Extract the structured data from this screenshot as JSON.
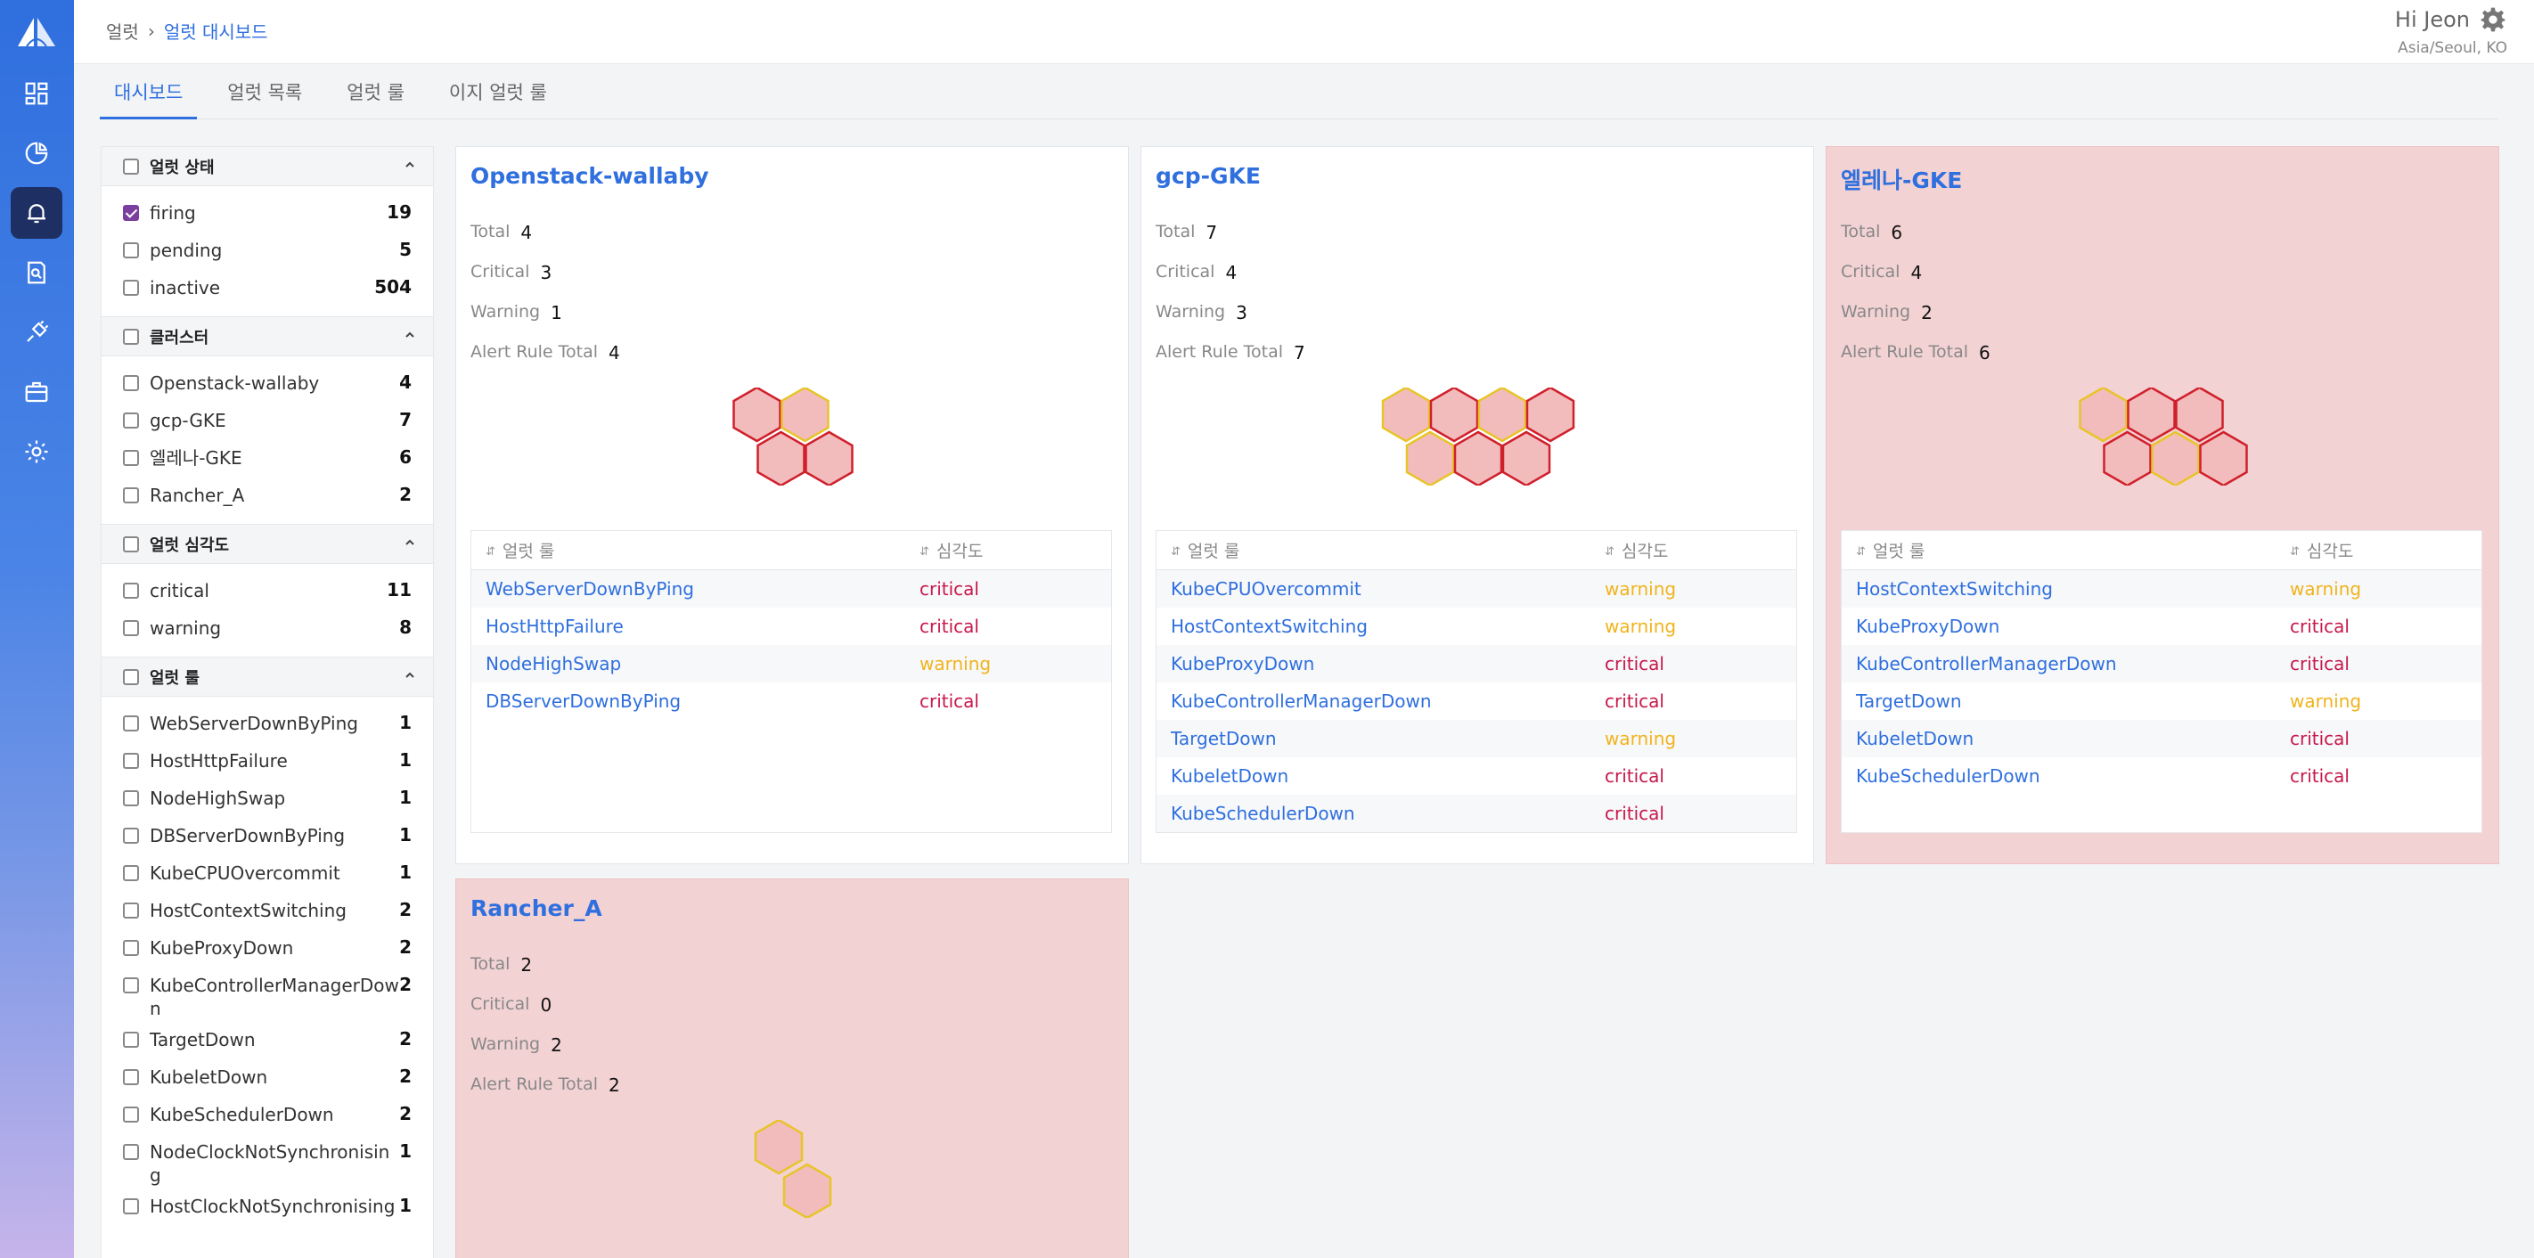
{
  "header": {
    "breadcrumb": [
      "얼럿",
      "얼럿 대시보드"
    ],
    "user_greeting": "Hi Jeon",
    "timezone": "Asia/Seoul, KO"
  },
  "tabs": [
    {
      "label": "대시보드",
      "active": true
    },
    {
      "label": "얼럿 목록",
      "active": false
    },
    {
      "label": "얼럿 룰",
      "active": false
    },
    {
      "label": "이지 얼럿 룰",
      "active": false
    }
  ],
  "filters": {
    "status": {
      "title": "얼럿 상태",
      "items": [
        {
          "label": "firing",
          "count": "19",
          "checked": true
        },
        {
          "label": "pending",
          "count": "5",
          "checked": false
        },
        {
          "label": "inactive",
          "count": "504",
          "checked": false
        }
      ]
    },
    "cluster": {
      "title": "클러스터",
      "items": [
        {
          "label": "Openstack-wallaby",
          "count": "4"
        },
        {
          "label": "gcp-GKE",
          "count": "7"
        },
        {
          "label": "엘레나-GKE",
          "count": "6"
        },
        {
          "label": "Rancher_A",
          "count": "2"
        }
      ]
    },
    "severity": {
      "title": "얼럿 심각도",
      "items": [
        {
          "label": "critical",
          "count": "11"
        },
        {
          "label": "warning",
          "count": "8"
        }
      ]
    },
    "rules": {
      "title": "얼럿 룰",
      "items": [
        {
          "label": "WebServerDownByPing",
          "count": "1"
        },
        {
          "label": "HostHttpFailure",
          "count": "1"
        },
        {
          "label": "NodeHighSwap",
          "count": "1"
        },
        {
          "label": "DBServerDownByPing",
          "count": "1"
        },
        {
          "label": "KubeCPUOvercommit",
          "count": "1"
        },
        {
          "label": "HostContextSwitching",
          "count": "2"
        },
        {
          "label": "KubeProxyDown",
          "count": "2"
        },
        {
          "label": "KubeControllerManagerDown",
          "count": "2"
        },
        {
          "label": "TargetDown",
          "count": "2"
        },
        {
          "label": "KubeletDown",
          "count": "2"
        },
        {
          "label": "KubeSchedulerDown",
          "count": "2"
        },
        {
          "label": "NodeClockNotSynchronising",
          "count": "1"
        },
        {
          "label": "HostClockNotSynchronising",
          "count": "1"
        }
      ]
    }
  },
  "stat_labels": {
    "total": "Total",
    "critical": "Critical",
    "warning": "Warning",
    "rule_total": "Alert Rule Total"
  },
  "table_headers": {
    "rule": "얼럿 룰",
    "severity": "심각도"
  },
  "colors": {
    "critical": "#c8174a",
    "warning": "#f0b31c",
    "accent": "#2f6fde",
    "alert_card": "#f3d2d3"
  },
  "clusters": [
    {
      "name": "Openstack-wallaby",
      "total": "4",
      "critical": "3",
      "warning": "1",
      "rule_total": "4",
      "alert": false,
      "hexes": [
        "critical",
        "warning",
        "critical",
        "critical"
      ],
      "rules": [
        {
          "rule": "WebServerDownByPing",
          "severity": "critical"
        },
        {
          "rule": "HostHttpFailure",
          "severity": "critical"
        },
        {
          "rule": "NodeHighSwap",
          "severity": "warning"
        },
        {
          "rule": "DBServerDownByPing",
          "severity": "critical"
        }
      ]
    },
    {
      "name": "gcp-GKE",
      "total": "7",
      "critical": "4",
      "warning": "3",
      "rule_total": "7",
      "alert": false,
      "hexes": [
        "warning",
        "critical",
        "warning",
        "critical",
        "warning",
        "critical",
        "critical"
      ],
      "rules": [
        {
          "rule": "KubeCPUOvercommit",
          "severity": "warning"
        },
        {
          "rule": "HostContextSwitching",
          "severity": "warning"
        },
        {
          "rule": "KubeProxyDown",
          "severity": "critical"
        },
        {
          "rule": "KubeControllerManagerDown",
          "severity": "critical"
        },
        {
          "rule": "TargetDown",
          "severity": "warning"
        },
        {
          "rule": "KubeletDown",
          "severity": "critical"
        },
        {
          "rule": "KubeSchedulerDown",
          "severity": "critical"
        }
      ]
    },
    {
      "name": "엘레나-GKE",
      "total": "6",
      "critical": "4",
      "warning": "2",
      "rule_total": "6",
      "alert": true,
      "hexes": [
        "warning",
        "critical",
        "critical",
        "critical",
        "warning",
        "critical"
      ],
      "rules": [
        {
          "rule": "HostContextSwitching",
          "severity": "warning"
        },
        {
          "rule": "KubeProxyDown",
          "severity": "critical"
        },
        {
          "rule": "KubeControllerManagerDown",
          "severity": "critical"
        },
        {
          "rule": "TargetDown",
          "severity": "warning"
        },
        {
          "rule": "KubeletDown",
          "severity": "critical"
        },
        {
          "rule": "KubeSchedulerDown",
          "severity": "critical"
        }
      ]
    },
    {
      "name": "Rancher_A",
      "total": "2",
      "critical": "0",
      "warning": "2",
      "rule_total": "2",
      "alert": true,
      "hexes": [
        "warning",
        "warning"
      ],
      "rules": []
    }
  ]
}
